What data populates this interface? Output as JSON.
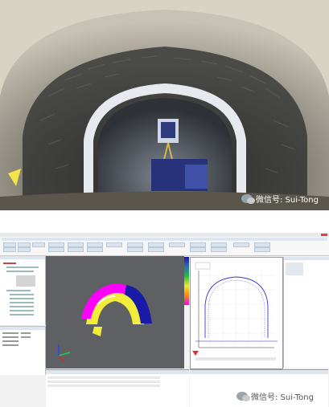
{
  "photo": {
    "watermark": "微信号: Sui-Tong"
  },
  "app": {
    "title_bar": "",
    "watermark": "微信号: Sui-Tong",
    "accent": "#2b6cb3",
    "view3d": {
      "background": "#5f6063",
      "ring_colors": [
        "#ff00ff",
        "#ffff00",
        "#1a1aa8"
      ]
    },
    "profile_view": {
      "curve_color": "#3a3ad0",
      "ground_color": "#6a6ad8"
    }
  }
}
